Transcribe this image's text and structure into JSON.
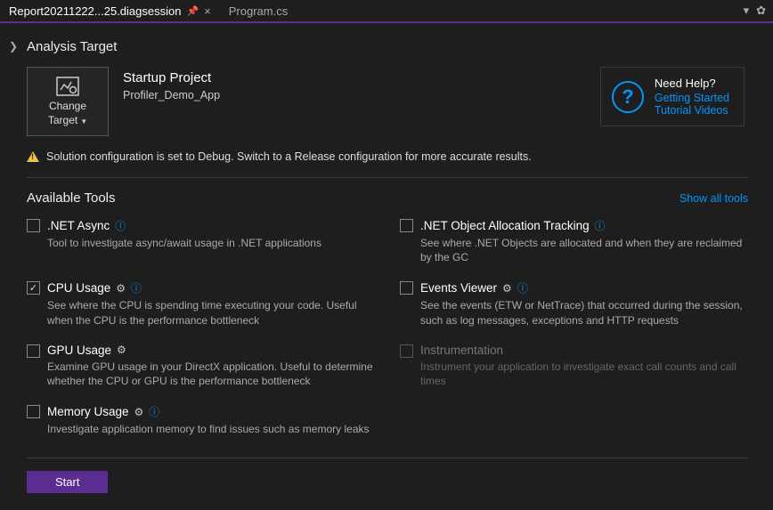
{
  "tabs": {
    "active": "Report20211222...25.diagsession",
    "inactive": "Program.cs"
  },
  "analysis": {
    "title": "Analysis Target",
    "change_label1": "Change",
    "change_label2": "Target",
    "startup_project": "Startup Project",
    "project_name": "Profiler_Demo_App"
  },
  "help": {
    "title": "Need Help?",
    "link1": "Getting Started",
    "link2": "Tutorial Videos"
  },
  "warning": "Solution configuration is set to Debug. Switch to a Release configuration for more accurate results.",
  "tools": {
    "title": "Available Tools",
    "show_all": "Show all tools",
    "items": [
      {
        "name": ".NET Async",
        "desc": "Tool to investigate async/await usage in .NET applications",
        "checked": false,
        "gear": false,
        "info": true,
        "disabled": false
      },
      {
        "name": ".NET Object Allocation Tracking",
        "desc": "See where .NET Objects are allocated and when they are reclaimed by the GC",
        "checked": false,
        "gear": false,
        "info": true,
        "disabled": false
      },
      {
        "name": "CPU Usage",
        "desc": "See where the CPU is spending time executing your code. Useful when the CPU is the performance bottleneck",
        "checked": true,
        "gear": true,
        "info": true,
        "disabled": false
      },
      {
        "name": "Events Viewer",
        "desc": "See the events (ETW or NetTrace) that occurred during the session, such as log messages, exceptions and HTTP requests",
        "checked": false,
        "gear": true,
        "info": true,
        "disabled": false
      },
      {
        "name": "GPU Usage",
        "desc": "Examine GPU usage in your DirectX application. Useful to determine whether the CPU or GPU is the performance bottleneck",
        "checked": false,
        "gear": true,
        "info": false,
        "disabled": false
      },
      {
        "name": "Instrumentation",
        "desc": "Instrument your application to investigate exact call counts and call times",
        "checked": false,
        "gear": false,
        "info": false,
        "disabled": true
      },
      {
        "name": "Memory Usage",
        "desc": "Investigate application memory to find issues such as memory leaks",
        "checked": false,
        "gear": true,
        "info": true,
        "disabled": false
      }
    ]
  },
  "footer": {
    "start": "Start"
  }
}
